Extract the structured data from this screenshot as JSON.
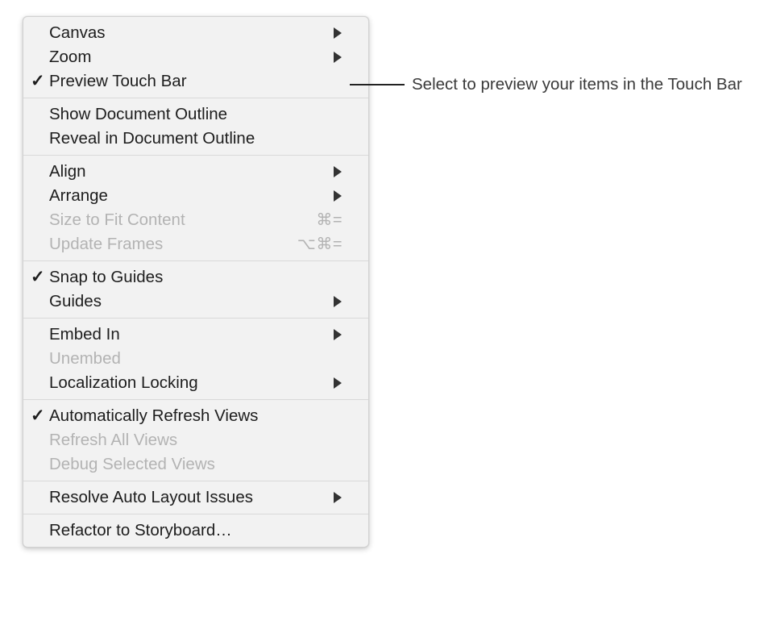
{
  "menu": {
    "name": "editor-context-menu",
    "groups": [
      {
        "items": [
          {
            "label": "Canvas",
            "checked": false,
            "disabled": false,
            "submenu": true,
            "shortcut": ""
          },
          {
            "label": "Zoom",
            "checked": false,
            "disabled": false,
            "submenu": true,
            "shortcut": ""
          },
          {
            "label": "Preview Touch Bar",
            "checked": true,
            "disabled": false,
            "submenu": false,
            "shortcut": ""
          }
        ]
      },
      {
        "items": [
          {
            "label": "Show Document Outline",
            "checked": false,
            "disabled": false,
            "submenu": false,
            "shortcut": ""
          },
          {
            "label": "Reveal in Document Outline",
            "checked": false,
            "disabled": false,
            "submenu": false,
            "shortcut": ""
          }
        ]
      },
      {
        "items": [
          {
            "label": "Align",
            "checked": false,
            "disabled": false,
            "submenu": true,
            "shortcut": ""
          },
          {
            "label": "Arrange",
            "checked": false,
            "disabled": false,
            "submenu": true,
            "shortcut": ""
          },
          {
            "label": "Size to Fit Content",
            "checked": false,
            "disabled": true,
            "submenu": false,
            "shortcut": "⌘="
          },
          {
            "label": "Update Frames",
            "checked": false,
            "disabled": true,
            "submenu": false,
            "shortcut": "⌥⌘="
          }
        ]
      },
      {
        "items": [
          {
            "label": "Snap to Guides",
            "checked": true,
            "disabled": false,
            "submenu": false,
            "shortcut": ""
          },
          {
            "label": "Guides",
            "checked": false,
            "disabled": false,
            "submenu": true,
            "shortcut": ""
          }
        ]
      },
      {
        "items": [
          {
            "label": "Embed In",
            "checked": false,
            "disabled": false,
            "submenu": true,
            "shortcut": ""
          },
          {
            "label": "Unembed",
            "checked": false,
            "disabled": true,
            "submenu": false,
            "shortcut": ""
          },
          {
            "label": "Localization Locking",
            "checked": false,
            "disabled": false,
            "submenu": true,
            "shortcut": ""
          }
        ]
      },
      {
        "items": [
          {
            "label": "Automatically Refresh Views",
            "checked": true,
            "disabled": false,
            "submenu": false,
            "shortcut": ""
          },
          {
            "label": "Refresh All Views",
            "checked": false,
            "disabled": true,
            "submenu": false,
            "shortcut": ""
          },
          {
            "label": "Debug Selected Views",
            "checked": false,
            "disabled": true,
            "submenu": false,
            "shortcut": ""
          }
        ]
      },
      {
        "items": [
          {
            "label": "Resolve Auto Layout Issues",
            "checked": false,
            "disabled": false,
            "submenu": true,
            "shortcut": ""
          }
        ]
      },
      {
        "items": [
          {
            "label": "Refactor to Storyboard…",
            "checked": false,
            "disabled": false,
            "submenu": false,
            "shortcut": ""
          }
        ]
      }
    ],
    "checkmark_glyph": "✓"
  },
  "callout": {
    "text": "Select to preview your items in the Touch Bar"
  },
  "colors": {
    "menu_background": "#f2f2f2",
    "menu_border": "#d2d2d2",
    "separator": "#d9d9d9",
    "text_enabled": "#1d1d1d",
    "text_disabled": "#b3b3b3",
    "callout_text": "#3a3a3a",
    "leader_line": "#222222",
    "page_background": "#ffffff"
  }
}
